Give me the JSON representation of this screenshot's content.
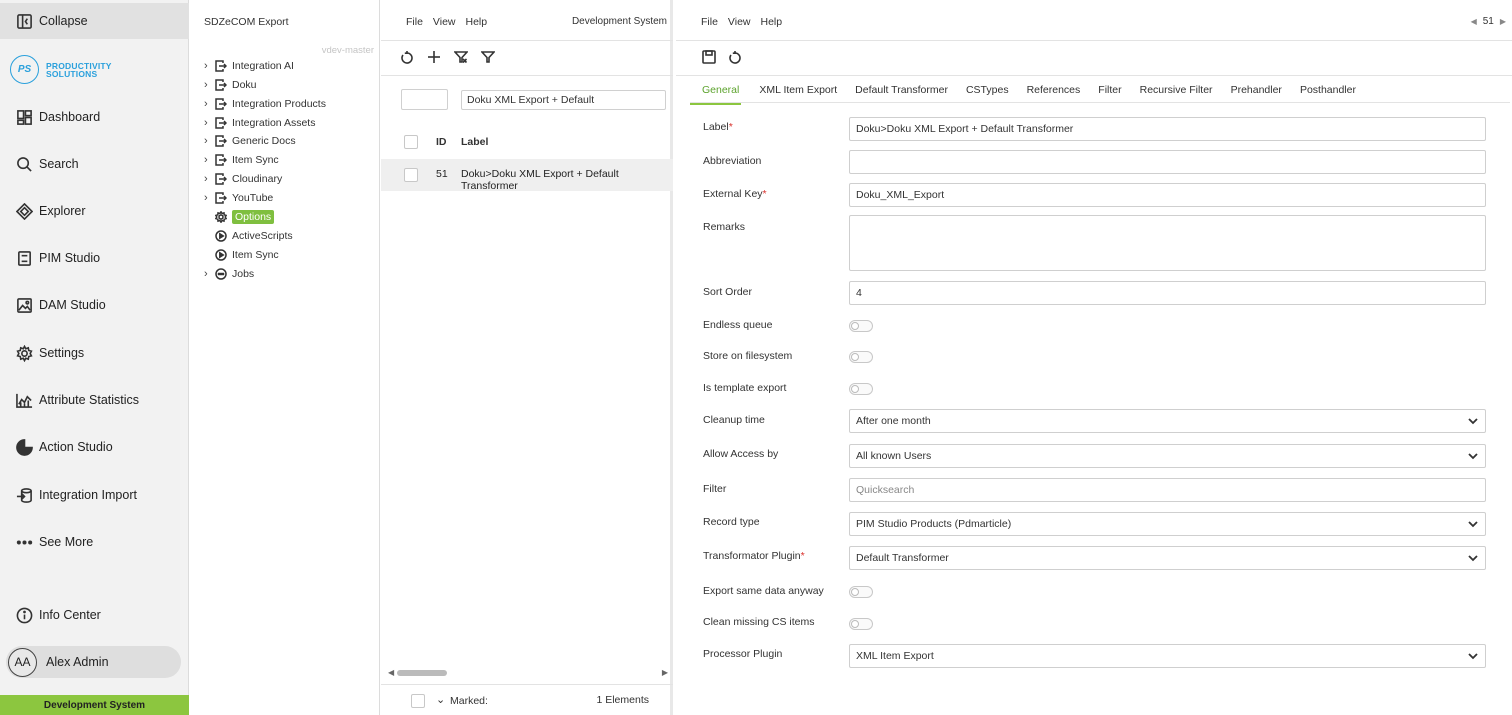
{
  "sidebar": {
    "collapse_label": "Collapse",
    "logo": {
      "mark": "PS",
      "line1": "PRODUCTIVITY",
      "line2": "SOLUTIONS"
    },
    "items": [
      {
        "label": "Dashboard",
        "icon": "dashboard-icon"
      },
      {
        "label": "Search",
        "icon": "search-icon"
      },
      {
        "label": "Explorer",
        "icon": "explorer-icon"
      },
      {
        "label": "PIM Studio",
        "icon": "pim-studio-icon"
      },
      {
        "label": "DAM Studio",
        "icon": "dam-studio-icon"
      },
      {
        "label": "Settings",
        "icon": "gear-icon"
      },
      {
        "label": "Attribute Statistics",
        "icon": "chart-icon"
      },
      {
        "label": "Action Studio",
        "icon": "action-studio-icon"
      },
      {
        "label": "Integration Import",
        "icon": "integration-import-icon"
      },
      {
        "label": "See More",
        "icon": "more-icon"
      }
    ],
    "info_center_label": "Info Center",
    "user": {
      "initials": "AA",
      "name": "Alex Admin"
    },
    "environment": "Development System"
  },
  "tree": {
    "title": "SDZeCOM Export",
    "version": "vdev-master",
    "nodes": [
      {
        "label": "Integration AI",
        "icon": "export-icon"
      },
      {
        "label": "Doku",
        "icon": "export-icon"
      },
      {
        "label": "Integration Products",
        "icon": "export-icon"
      },
      {
        "label": "Integration Assets",
        "icon": "export-icon"
      },
      {
        "label": "Generic Docs",
        "icon": "export-icon"
      },
      {
        "label": "Item Sync",
        "icon": "export-icon"
      },
      {
        "label": "Cloudinary",
        "icon": "export-icon"
      },
      {
        "label": "YouTube",
        "icon": "export-icon"
      },
      {
        "label": "Options",
        "icon": "gear-icon"
      },
      {
        "label": "ActiveScripts",
        "icon": "play-circle-icon"
      },
      {
        "label": "Item Sync",
        "icon": "play-circle-icon"
      },
      {
        "label": "Jobs",
        "icon": "jobs-icon"
      }
    ]
  },
  "list": {
    "menu": [
      "File",
      "View",
      "Help"
    ],
    "environment": "Development System",
    "id_filter": "",
    "label_filter": "Doku XML Export + Default",
    "columns": {
      "id": "ID",
      "label": "Label"
    },
    "rows": [
      {
        "id": "51",
        "label": "Doku>Doku XML Export + Default Transformer"
      }
    ],
    "footer": {
      "marked": "Marked:",
      "count": "1 Elements"
    }
  },
  "detail": {
    "menu": [
      "File",
      "View",
      "Help"
    ],
    "pager": "51",
    "tabs": [
      "General",
      "XML Item Export",
      "Default Transformer",
      "CSTypes",
      "References",
      "Filter",
      "Recursive Filter",
      "Prehandler",
      "Posthandler"
    ],
    "active_tab": "General",
    "fields": {
      "label": {
        "label": "Label",
        "value": "Doku>Doku XML Export + Default Transformer"
      },
      "abbreviation": {
        "label": "Abbreviation",
        "value": ""
      },
      "external_key": {
        "label": "External Key",
        "value": "Doku_XML_Export"
      },
      "remarks": {
        "label": "Remarks",
        "value": ""
      },
      "sort_order": {
        "label": "Sort Order",
        "value": "4"
      },
      "endless_queue": {
        "label": "Endless queue",
        "checked": false
      },
      "store_on_filesystem": {
        "label": "Store on filesystem",
        "checked": false
      },
      "is_template_export": {
        "label": "Is template export",
        "checked": false
      },
      "cleanup_time": {
        "label": "Cleanup time",
        "value": "After one month"
      },
      "allow_access_by": {
        "label": "Allow Access by",
        "value": "All known Users"
      },
      "filter": {
        "label": "Filter",
        "placeholder": "Quicksearch"
      },
      "record_type": {
        "label": "Record type",
        "value": "PIM Studio Products (Pdmarticle)"
      },
      "transformator_plugin": {
        "label": "Transformator Plugin",
        "value": "Default Transformer"
      },
      "export_same_data_anyway": {
        "label": "Export same data anyway",
        "checked": false
      },
      "clean_missing_cs_items": {
        "label": "Clean missing CS items",
        "checked": false
      },
      "processor_plugin": {
        "label": "Processor Plugin",
        "value": "XML Item Export"
      }
    },
    "required_marker": "*"
  },
  "colors": {
    "accent_green": "#8cc63f",
    "brand_blue": "#2aa0dc",
    "required_red": "#d9302b"
  }
}
